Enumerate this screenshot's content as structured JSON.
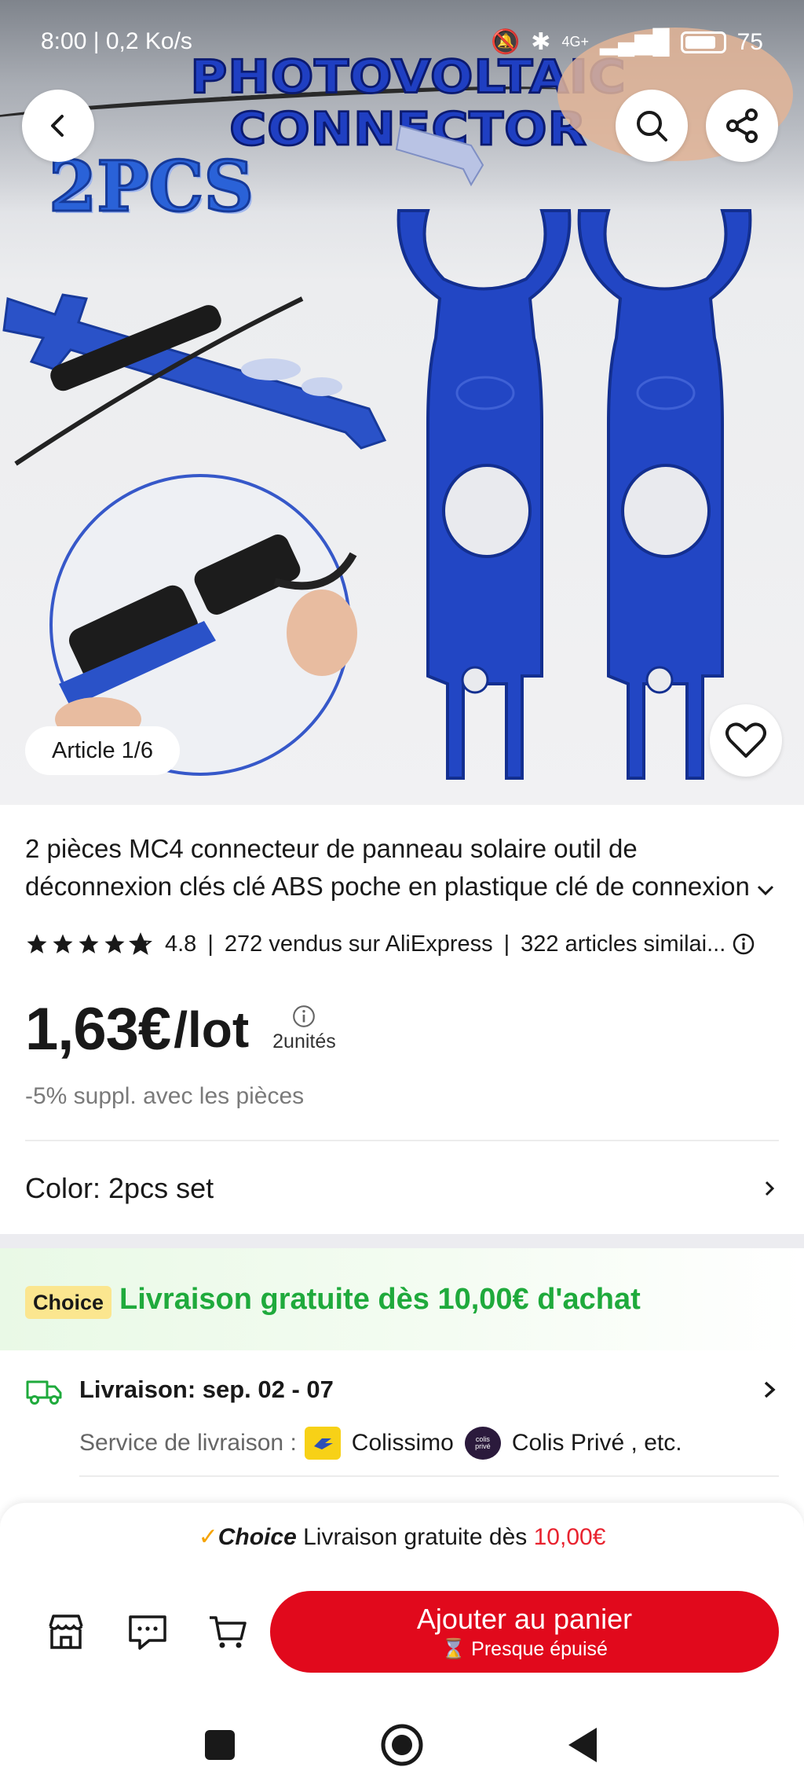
{
  "status_bar": {
    "time_speed": "8:00 | 0,2 Ko/s",
    "network": "4G+",
    "battery": "75"
  },
  "hero": {
    "banner_title": "PHOTOVOLTAIC CONNECTOR",
    "banner_sub": "2PCS",
    "article_counter": "Article 1/6",
    "icons": [
      "back-icon",
      "search-icon",
      "share-icon",
      "heart-icon"
    ]
  },
  "product": {
    "title_line1": "2 pièces MC4 connecteur de panneau solaire outil de",
    "title_line2": "déconnexion clés clé ABS poche en plastique clé de connexion",
    "rating": "4.8",
    "rating_stars": 4.8,
    "sold": "272 vendus sur AliExpress",
    "similar": "322 articles similai...",
    "price": "1,63€",
    "price_unit": "/lot",
    "units": "2unités",
    "extra_discount": "-5% suppl. avec les pièces",
    "color_label": "Color: 2pcs set"
  },
  "shipping": {
    "choice_badge": "Choice",
    "choice_text": "Livraison gratuite dès 10,00€ d'achat",
    "delivery_title": "Livraison: sep. 02 - 07",
    "service_label": "Service de livraison :",
    "carrier1": "Colissimo",
    "carrier2": "Colis Privé , etc.",
    "carrier2_logo": "colis privé"
  },
  "bottom": {
    "promo_choice": "Choice",
    "promo_text": "Livraison gratuite dès",
    "promo_price": "10,00€",
    "cart_label": "Ajouter au panier",
    "cart_sub": "Presque épuisé"
  },
  "colors": {
    "accent_red": "#e1091c",
    "choice_green": "#1faa3c",
    "choice_badge": "#fbe68f",
    "product_blue": "#1f3fc2"
  }
}
